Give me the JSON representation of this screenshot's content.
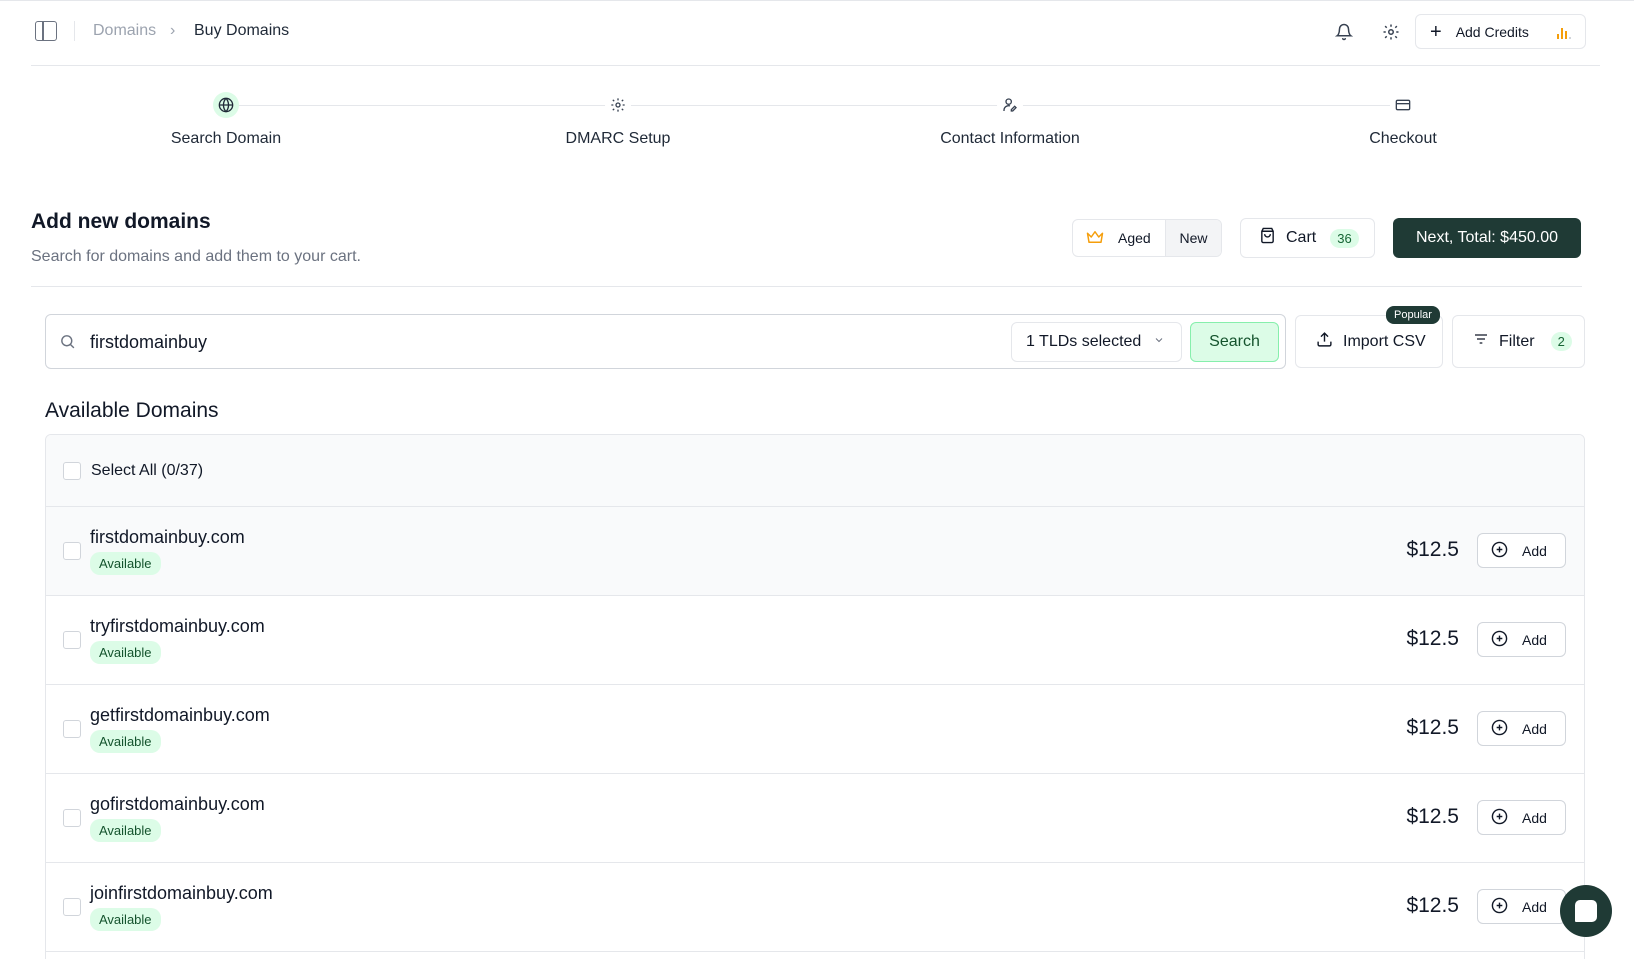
{
  "header": {
    "breadcrumb_parent": "Domains",
    "breadcrumb_current": "Buy Domains",
    "add_credits_label": "Add Credits"
  },
  "steps": [
    {
      "label": "Search Domain",
      "icon": "globe-icon",
      "active": true
    },
    {
      "label": "DMARC Setup",
      "icon": "gear-icon",
      "active": false
    },
    {
      "label": "Contact Information",
      "icon": "user-pen-icon",
      "active": false
    },
    {
      "label": "Checkout",
      "icon": "credit-card-icon",
      "active": false
    }
  ],
  "section": {
    "title": "Add new domains",
    "subtitle": "Search for domains and add them to your cart.",
    "aged_label": "Aged",
    "new_label": "New",
    "cart_label": "Cart",
    "cart_count": "36",
    "next_label": "Next, Total: $450.00"
  },
  "search": {
    "value": "firstdomainbuy",
    "tld_label": "1 TLDs selected",
    "search_button": "Search",
    "import_label": "Import CSV",
    "popular_badge": "Popular",
    "filter_label": "Filter",
    "filter_count": "2"
  },
  "list": {
    "title": "Available Domains",
    "select_all_label": "Select All (0/37)",
    "add_label": "Add",
    "domains": [
      {
        "name": "firstdomainbuy.com",
        "status": "Available",
        "price": "$12.5"
      },
      {
        "name": "tryfirstdomainbuy.com",
        "status": "Available",
        "price": "$12.5"
      },
      {
        "name": "getfirstdomainbuy.com",
        "status": "Available",
        "price": "$12.5"
      },
      {
        "name": "gofirstdomainbuy.com",
        "status": "Available",
        "price": "$12.5"
      },
      {
        "name": "joinfirstdomainbuy.com",
        "status": "Available",
        "price": "$12.5"
      }
    ]
  },
  "colors": {
    "brand_dark": "#1f3a35",
    "success_bg": "#dcfce7",
    "credit_bars": "#f59e0b"
  }
}
